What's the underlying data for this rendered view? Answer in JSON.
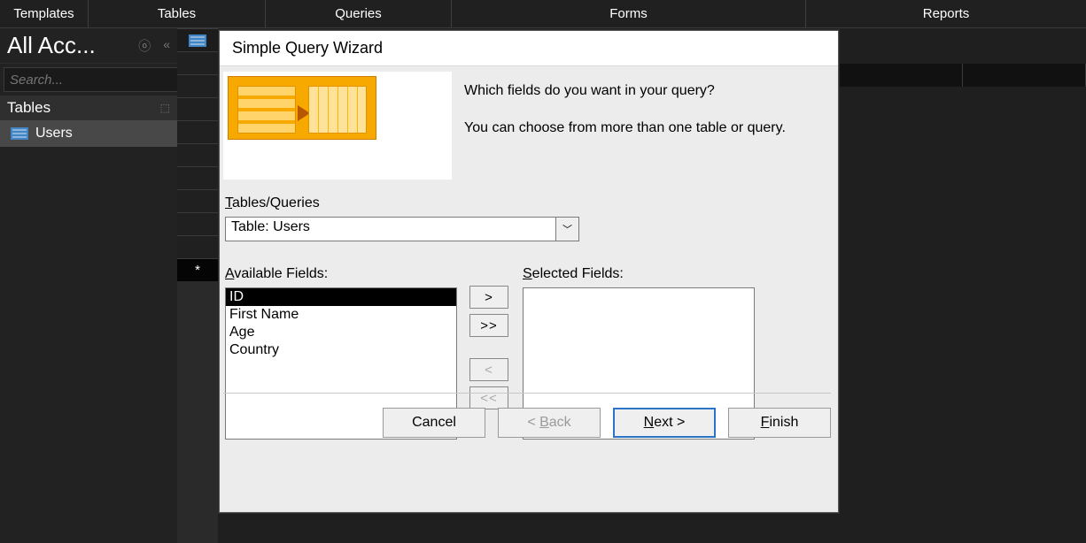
{
  "ribbon": {
    "templates": "Templates",
    "tables": "Tables",
    "queries": "Queries",
    "forms": "Forms",
    "reports": "Reports"
  },
  "nav": {
    "title": "All Acc...",
    "search_placeholder": "Search...",
    "section_header": "Tables",
    "items": [
      {
        "label": "Users"
      }
    ]
  },
  "dialog": {
    "title": "Simple Query Wizard",
    "prompt1": "Which fields do you want in your query?",
    "prompt2": "You can choose from more than one table or query.",
    "tables_queries_label_pre": "T",
    "tables_queries_label_rest": "ables/Queries",
    "combo_value": "Table: Users",
    "available_label_pre": "A",
    "available_label_rest": "vailable Fields:",
    "selected_label_pre": "S",
    "selected_label_rest": "elected Fields:",
    "available_fields": [
      "ID",
      "First Name",
      "Age",
      "Country"
    ],
    "selected_fields": [],
    "move_add": ">",
    "move_add_all": ">>",
    "move_remove": "<",
    "move_remove_all": "<<",
    "btn_cancel": "Cancel",
    "btn_back_pre": "< ",
    "btn_back_u": "B",
    "btn_back_rest": "ack",
    "btn_next_u": "N",
    "btn_next_rest": "ext >",
    "btn_finish_u": "F",
    "btn_finish_rest": "inish"
  }
}
